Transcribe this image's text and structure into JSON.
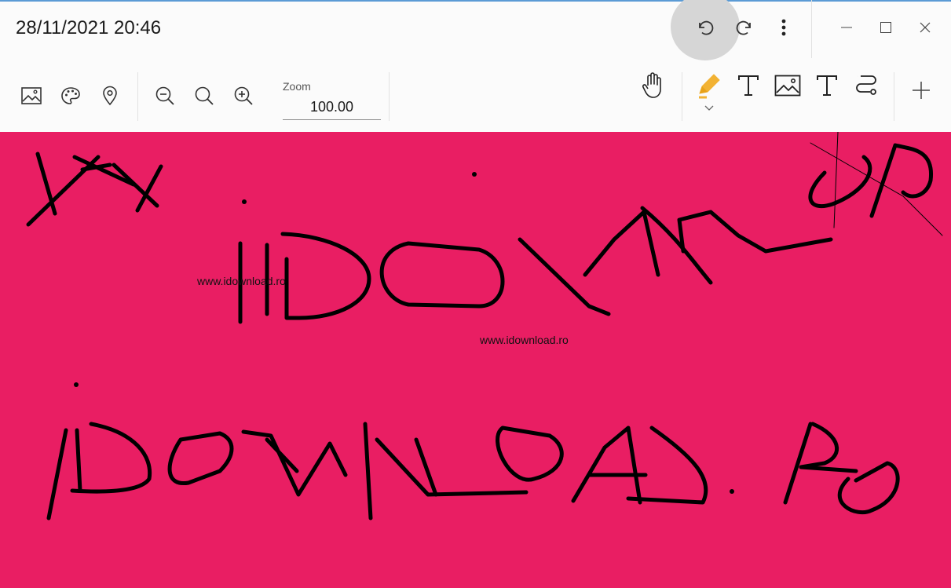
{
  "window": {
    "title": "28/11/2021 20:46",
    "accent_color": "#5b9bd5"
  },
  "toolbar_top": {
    "undo_icon": "undo-icon",
    "redo_icon": "redo-icon",
    "more_icon": "more-vertical-icon",
    "minimize_icon": "minimize-icon",
    "maximize_icon": "maximize-icon",
    "close_icon": "close-icon"
  },
  "toolbar": {
    "left_icons": [
      "image-icon",
      "palette-icon",
      "location-pin-icon"
    ],
    "zoom_icons": [
      "zoom-out-icon",
      "zoom-fit-icon",
      "zoom-in-icon"
    ],
    "zoom": {
      "label": "Zoom",
      "value": "100.00"
    },
    "tools": [
      "hand-icon",
      "pen-icon",
      "text-icon",
      "insert-image-icon",
      "text-icon",
      "stroke-to-shape-icon",
      "add-icon"
    ],
    "pen_color": "#f2b233"
  },
  "canvas": {
    "background": "#e91e63",
    "watermarks": [
      "www.idownload.ro",
      "www.idownload.ro"
    ]
  }
}
